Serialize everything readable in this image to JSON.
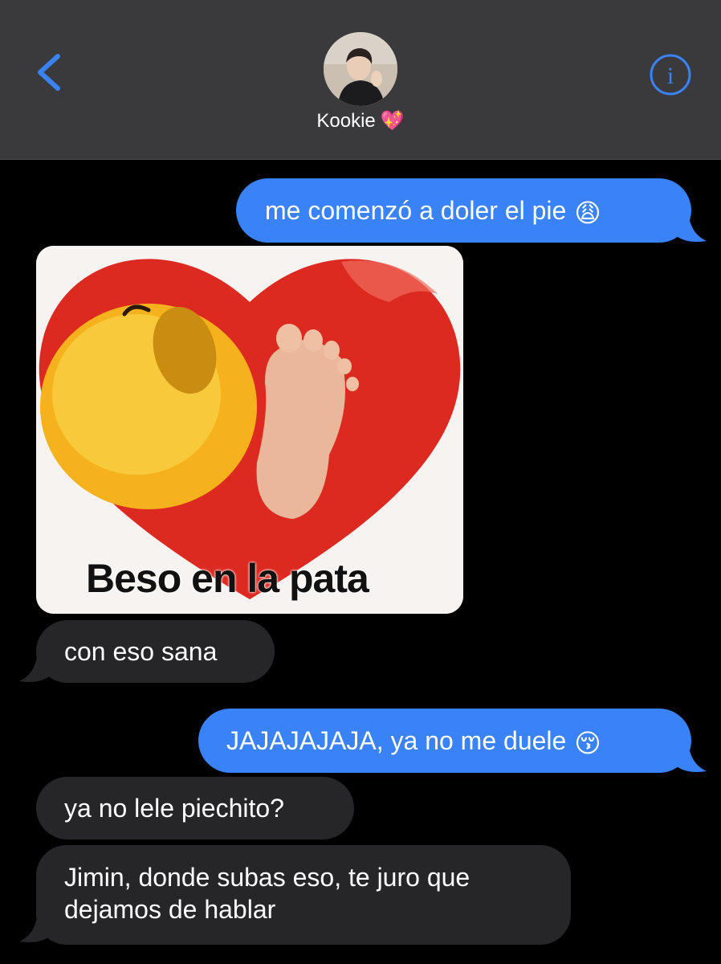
{
  "header": {
    "contact_name": "Kookie",
    "contact_emoji": "💖"
  },
  "messages": [
    {
      "id": "m1",
      "side": "sent",
      "text": "me comenzó a doler el pie",
      "emoji": "😩"
    },
    {
      "id": "m2",
      "side": "received",
      "type": "image",
      "caption": "Beso en la pata"
    },
    {
      "id": "m3",
      "side": "received",
      "text": "con eso sana"
    },
    {
      "id": "m4",
      "side": "sent",
      "text": "JAJAJAJAJA, ya no me duele",
      "emoji": "😚"
    },
    {
      "id": "m5",
      "side": "received",
      "text": "ya no lele piechito?"
    },
    {
      "id": "m6",
      "side": "received",
      "line1": "Jimin, donde subas eso, te juro que",
      "line2": "dejamos de hablar"
    }
  ],
  "colors": {
    "sent_bubble": "#3a82f7",
    "received_bubble": "#262628",
    "header_bg": "#3a3a3c",
    "accent": "#3a82f7"
  },
  "icons": {
    "back": "chevron-left-icon",
    "info": "info-circle-icon"
  }
}
